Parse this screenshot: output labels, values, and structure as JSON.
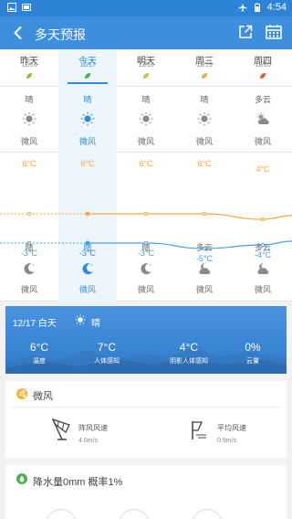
{
  "status_bar": {
    "time": "4:54"
  },
  "app_bar": {
    "title": "多天预报"
  },
  "days": [
    {
      "name": "昨天",
      "date": "12/16",
      "leaf_color": "#8bc34a",
      "day_cond": "晴",
      "day_icon": "sun-icon",
      "day_wind": "微风",
      "high": "6°C",
      "low": "-3°C",
      "night_cond": "晴",
      "night_icon": "moon-icon",
      "night_wind": "微风"
    },
    {
      "name": "今天",
      "date": "12/17",
      "leaf_color": "#4caf50",
      "day_cond": "晴",
      "day_icon": "sun-icon",
      "day_wind": "微风",
      "high": "6°C",
      "low": "-3°C",
      "night_cond": "晴",
      "night_icon": "moon-icon",
      "night_wind": "微风"
    },
    {
      "name": "明天",
      "date": "12/18",
      "leaf_color": "#c8c24a",
      "day_cond": "晴",
      "day_icon": "sun-icon",
      "day_wind": "微风",
      "high": "6°C",
      "low": "-3°C",
      "night_cond": "晴",
      "night_icon": "moon-icon",
      "night_wind": "微风"
    },
    {
      "name": "周三",
      "date": "12/19",
      "leaf_color": "#d8b44a",
      "day_cond": "晴",
      "day_icon": "sun-icon",
      "day_wind": "微风",
      "high": "6°C",
      "low": "-5°C",
      "night_cond": "多云",
      "night_icon": "cloud-moon-icon",
      "night_wind": "微风"
    },
    {
      "name": "周四",
      "date": "12/20",
      "leaf_color": "#e05a4a",
      "day_cond": "多云",
      "day_icon": "cloud-sun-icon",
      "day_wind": "微风",
      "high": "4°C",
      "low": "-4°C",
      "night_cond": "多云",
      "night_icon": "cloud-moon-icon",
      "night_wind": "微风"
    }
  ],
  "today_index": 1,
  "detail": {
    "date": "12/17 白天",
    "cond": "晴",
    "metrics": [
      {
        "value": "6°C",
        "label": "温度"
      },
      {
        "value": "7°C",
        "label": "人体感知"
      },
      {
        "value": "4°C",
        "label": "阴影人体感知"
      },
      {
        "value": "0%",
        "label": "云量"
      }
    ]
  },
  "wind": {
    "title": "微风",
    "gust_label": "阵风风速",
    "gust_value": "4.6m/s",
    "avg_label": "平均风速",
    "avg_value": "0.9m/s"
  },
  "rain": {
    "text": "降水量0mm 概率1%"
  },
  "colors": {
    "primary": "#3d8fde",
    "high_temp": "#f2a93b",
    "low_temp": "#4aa0e6"
  }
}
